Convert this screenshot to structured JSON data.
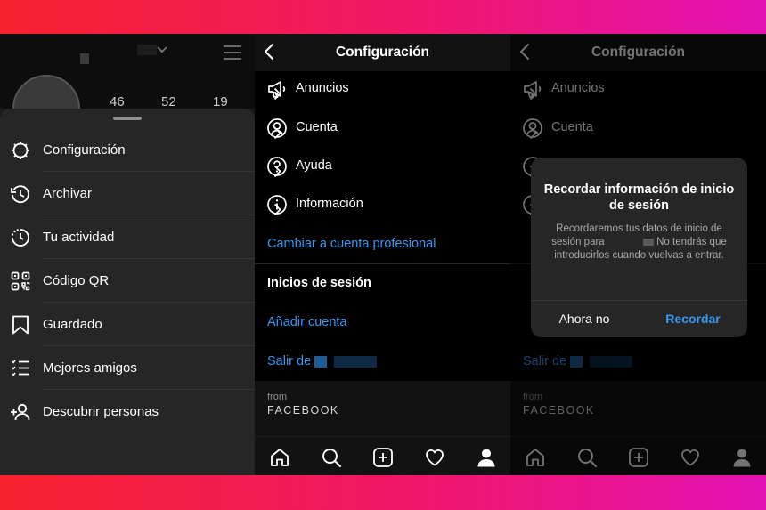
{
  "profile": {
    "stats": [
      "46",
      "52",
      "19"
    ]
  },
  "menu": [
    {
      "label": "Configuración",
      "icon": "settings-gear-icon"
    },
    {
      "label": "Archivar",
      "icon": "archive-clock-icon"
    },
    {
      "label": "Tu actividad",
      "icon": "activity-icon"
    },
    {
      "label": "Código QR",
      "icon": "qr-code-icon"
    },
    {
      "label": "Guardado",
      "icon": "bookmark-icon"
    },
    {
      "label": "Mejores amigos",
      "icon": "close-friends-list-icon"
    },
    {
      "label": "Descubrir personas",
      "icon": "add-person-icon"
    }
  ],
  "settings": {
    "title": "Configuración",
    "rows": [
      {
        "label": "Anuncios",
        "icon": "megaphone-icon"
      },
      {
        "label": "Cuenta",
        "icon": "account-icon"
      },
      {
        "label": "Ayuda",
        "icon": "help-icon"
      },
      {
        "label": "Información",
        "icon": "info-icon"
      }
    ],
    "switch_pro": "Cambiar a cuenta profesional",
    "logins_header": "Inicios de sesión",
    "add_account": "Añadir cuenta",
    "logout": "Salir de",
    "from": "from",
    "brand": "FACEBOOK"
  },
  "dialog": {
    "title": "Recordar información de inicio de sesión",
    "body_1": "Recordaremos tus datos de inicio de sesión para",
    "body_2": "No tendrás que introducirlos cuando vuelvas a entrar.",
    "cancel": "Ahora no",
    "confirm": "Recordar"
  },
  "tabs": [
    "home-icon",
    "search-icon",
    "new-post-icon",
    "activity-heart-icon",
    "profile-icon"
  ],
  "colors": {
    "accent_blue": "#3897f0",
    "band_gradient": [
      "#f5222e",
      "#f0176a",
      "#e212b4"
    ],
    "sheet_bg": "#262626",
    "background": "#000000"
  }
}
